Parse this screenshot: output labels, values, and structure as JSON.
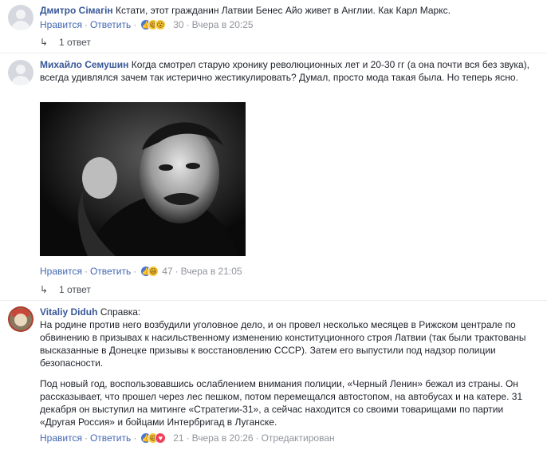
{
  "comments": [
    {
      "author": "Дмитро Сімагін",
      "text": "Кстати, этот гражданин Латвии Бенес Айо живет в Англии. Как Карл Маркс.",
      "like": "Нравится",
      "reply": "Ответить",
      "reaction_count": "30",
      "time": "Вчера в 20:25",
      "replies": "1 ответ"
    },
    {
      "author": "Михайло Семушин",
      "text": "Когда смотрел старую хронику революционных лет и 20-30 гг (а она почти вся без звука), всегда удивлялся зачем так истерично жестикулировать? Думал, просто мода такая была. Но теперь ясно.",
      "like": "Нравится",
      "reply": "Ответить",
      "reaction_count": "47",
      "time": "Вчера в 21:05",
      "replies": "1 ответ"
    },
    {
      "author": "Vitaliy Diduh",
      "text": "Справка:",
      "paragraph1": "На родине против него возбудили уголовное дело, и он провел несколько месяцев в Рижском централе по обвинению в призывах к насильственному изменению конституционного строя Латвии (так были трактованы высказанные в Донецке призывы к восстановлению СССР). Затем его выпустили под надзор полиции безопасности.",
      "paragraph2": "Под новый год, воспользовавшись ослаблением внимания полиции, «Черный Ленин» бежал из страны. Он рассказывает, что прошел через лес пешком, потом перемещался автостопом, на автобусах и на катере. 31 декабря он выступил на митинге «Стратегии-31», а сейчас находится со своими товарищами по партии «Другая Россия» и бойцами Интербригад в Луганске.",
      "like": "Нравится",
      "reply": "Ответить",
      "reaction_count": "21",
      "time": "Вчера в 20:26",
      "edited": "Отредактирован"
    }
  ],
  "separator": "·",
  "icons": {
    "reply_arrow": "reply-arrow-icon",
    "reactions": [
      "like-icon",
      "haha-icon",
      "wow-icon",
      "heart-icon"
    ]
  },
  "colors": {
    "author": "#385898",
    "link": "#4267b2",
    "meta": "#90949c"
  }
}
